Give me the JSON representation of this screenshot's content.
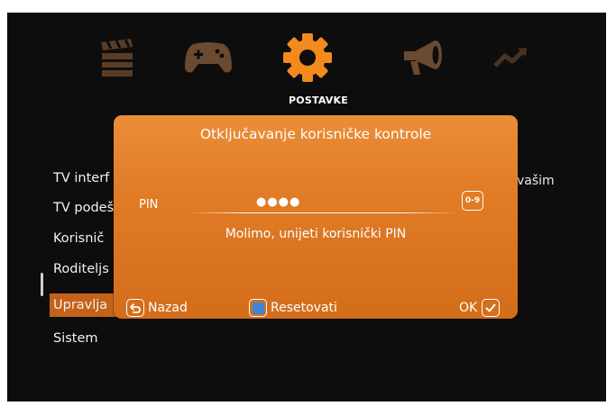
{
  "top_nav": {
    "icons": [
      "film-clapper-icon",
      "gamepad-icon",
      "gear-icon",
      "megaphone-icon",
      "trending-chart-icon"
    ],
    "active": "gear-icon",
    "active_label": "POSTAVKE"
  },
  "menu": {
    "items": [
      "TV interf",
      "TV podeš",
      "Korisnič",
      "Roditeljs",
      "Upravlja",
      "Sistem"
    ],
    "selected_index": 4
  },
  "right_text": "vašim",
  "dialog": {
    "title": "Otključavanje korisničke kontrole",
    "pin_label": "PIN",
    "pin_value": "●●●●",
    "range_button": "0-9",
    "message": "Molimo, unijeti korisnički PIN",
    "back_label": "Nazad",
    "reset_label": "Resetovati",
    "ok_label": "OK"
  },
  "colors": {
    "accent": "#e07b26",
    "selection": "#c4621a",
    "reset_square": "#3f86d9",
    "background": "#0d0d0d"
  }
}
